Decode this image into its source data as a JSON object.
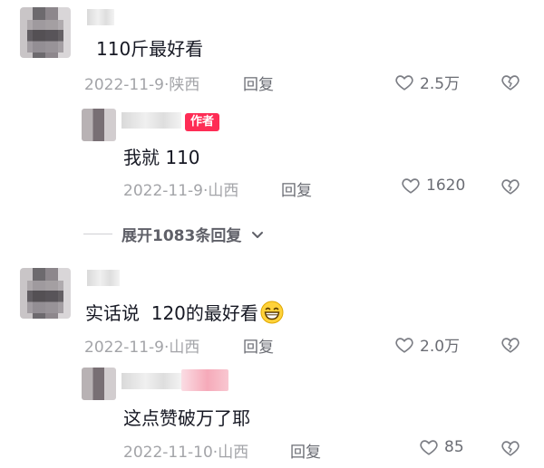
{
  "comments": [
    {
      "text": "110斤最好看",
      "date": "2022-11-9",
      "location": "陕西",
      "reply_label": "回复",
      "likes": "2.5万",
      "reply": {
        "badge": "作者",
        "text": "我就 110",
        "date": "2022-11-9",
        "location": "山西",
        "reply_label": "回复",
        "likes": "1620"
      },
      "expand_label": "展开1083条回复"
    },
    {
      "text": "实话说  120的最好看",
      "date": "2022-11-9",
      "location": "山西",
      "reply_label": "回复",
      "likes": "2.0万",
      "reply": {
        "text": "这点赞破万了耶",
        "date": "2022-11-10",
        "location": "山西",
        "reply_label": "回复",
        "likes": "85"
      }
    }
  ],
  "meta_separator": "·",
  "icons": {
    "like": "heart-outline-icon",
    "dislike": "broken-heart-icon",
    "expand": "chevron-down-icon",
    "emoji": "grinning-face-emoji"
  },
  "colors": {
    "author_badge": "#fe2c55",
    "meta_text": "#a3a4a8",
    "action_text": "#6b6d74"
  }
}
